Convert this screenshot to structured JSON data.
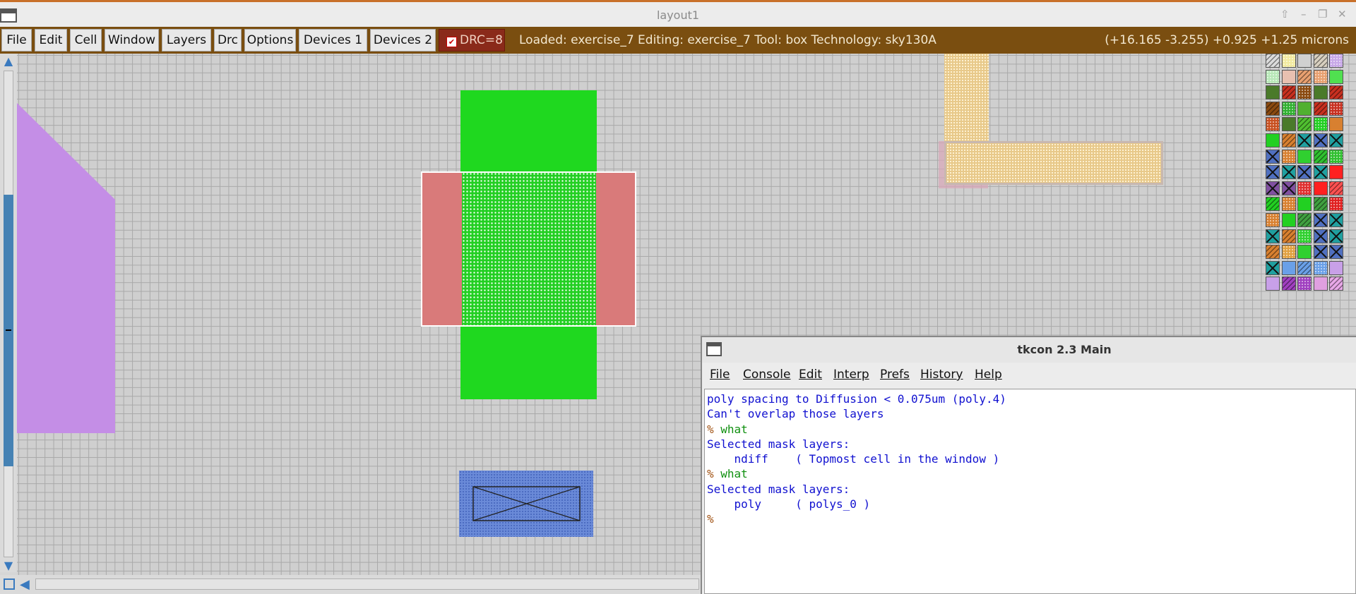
{
  "window": {
    "title": "layout1",
    "controls": [
      "⇧",
      "–",
      "❐",
      "✕"
    ]
  },
  "menubar": {
    "items": [
      "File",
      "Edit",
      "Cell",
      "Window",
      "Layers",
      "Drc",
      "Options",
      "Devices 1",
      "Devices 2"
    ],
    "drc_label": "DRC=8",
    "drc_checked": true,
    "status": "Loaded: exercise_7 Editing: exercise_7 Tool: box  Technology: sky130A",
    "coords": "(+16.165 -3.255) +0.925 +1.25 microns"
  },
  "layers": {
    "nwell": "#c48ee6",
    "ndiff": "#1fd81f",
    "poly": "#d97a7a",
    "li": "#6a8ad8",
    "metal_gold": "#e8c98a",
    "selection": "#ffffff"
  },
  "palette_colors": [
    [
      "#dcdcdc",
      "#f2eaa0",
      "#d0d0d0",
      "#d8d0c0",
      "#c8a8e8"
    ],
    [
      "#b8e8b8",
      "#e8c0b0",
      "#e8a070",
      "#e8a070",
      "#50e050"
    ],
    [
      "#4a7a2a",
      "#c83020",
      "#8a4a10",
      "#4a7a2a",
      "#c83020"
    ],
    [
      "#8a4a10",
      "#30b030",
      "#50b030",
      "#c83020",
      "#c83020"
    ],
    [
      "#c85020",
      "#4a7a2a",
      "#50c030",
      "#22d022",
      "#d88030"
    ],
    [
      "#22d022",
      "#d88030",
      "#20a0a0",
      "#5070c0",
      "#20a0a0"
    ],
    [
      "#5070c0",
      "#d88030",
      "#30d030",
      "#30c030",
      "#30c030"
    ],
    [
      "#5070c0",
      "#20a0a0",
      "#5070c0",
      "#20a0a0",
      "#ff2020"
    ],
    [
      "#8050a0",
      "#8050a0",
      "#e03030",
      "#ff2020",
      "#ff5050"
    ],
    [
      "#22d022",
      "#d88030",
      "#22d022",
      "#40a040",
      "#e02020"
    ],
    [
      "#d88030",
      "#22d022",
      "#40a040",
      "#5070c0",
      "#20a0a0"
    ],
    [
      "#20a0a0",
      "#d88030",
      "#30d030",
      "#5070c0",
      "#20a0a0"
    ],
    [
      "#d88030",
      "#e0a040",
      "#30d030",
      "#5070c0",
      "#5070c0"
    ],
    [
      "#20a0a0",
      "#6aa0e8",
      "#6aa0e8",
      "#6aa0e8",
      "#c8a0e8"
    ],
    [
      "#c8a0e8",
      "#a040c0",
      "#a040c0",
      "#e0a0e0",
      "#e8a8e8"
    ]
  ],
  "tkcon": {
    "title": "tkcon 2.3 Main",
    "menu": [
      "File",
      "Console",
      "Edit",
      "Interp",
      "Prefs",
      "History",
      "Help"
    ],
    "lines": [
      {
        "text": "poly spacing to Diffusion < 0.075um (poly.4)",
        "color": "#1010d0"
      },
      {
        "text": "Can't overlap those layers",
        "color": "#1010d0"
      },
      {
        "prompt": "% ",
        "text": "what",
        "color": "#109010"
      },
      {
        "text": "Selected mask layers:",
        "color": "#1010d0"
      },
      {
        "text": "    ndiff    ( Topmost cell in the window )",
        "color": "#1010d0"
      },
      {
        "prompt": "% ",
        "text": "what",
        "color": "#109010"
      },
      {
        "text": "Selected mask layers:",
        "color": "#1010d0"
      },
      {
        "text": "    poly     ( polys_0 )",
        "color": "#1010d0"
      },
      {
        "prompt": "%",
        "text": "",
        "color": "#109010"
      }
    ]
  }
}
